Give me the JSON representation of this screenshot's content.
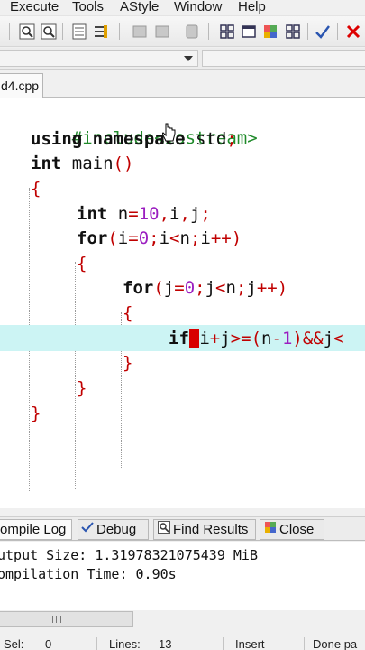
{
  "menu": [
    "Execute",
    "Tools",
    "AStyle",
    "Window",
    "Help"
  ],
  "toolbar": {
    "icons": [
      "find-icon",
      "find-next-icon",
      "goto-icon",
      "bookmark-icon",
      "indent-icon",
      "unindent-icon",
      "toggle-comment-icon",
      "grid-icon",
      "window-icon",
      "layout-icon",
      "tile-icon",
      "check-icon",
      "close-icon"
    ]
  },
  "tab": {
    "filename": "d4.cpp"
  },
  "code": {
    "l1": {
      "pp": "#include<iostream>"
    },
    "l2": {
      "kw": "using namespace",
      "id": "std",
      "sym": ";"
    },
    "l3": {
      "kw": "int",
      "id": "main",
      "sym": "()"
    },
    "l4": {
      "sym": "{"
    },
    "l5": {
      "kw": "int",
      "a": "n",
      "b": "=",
      "n": "10",
      "c": ",",
      "d": "i",
      "e": ",",
      "f": "j",
      "g": ";"
    },
    "l6": {
      "kw": "for",
      "a": "(",
      "b": "i",
      "c": "=",
      "n": "0",
      "d": ";",
      "e": "i",
      "f": "<",
      "g": "n",
      "h": ";",
      "i": "i",
      "j": "++)"
    },
    "l7": {
      "sym": "{"
    },
    "l8": {
      "kw": "for",
      "a": "(",
      "b": "j",
      "c": "=",
      "n": "0",
      "d": ";",
      "e": "j",
      "f": "<",
      "g": "n",
      "h": ";",
      "i": "j",
      "j": "++)"
    },
    "l9": {
      "sym": "{"
    },
    "l10": {
      "kw": "if",
      "a": "i",
      "b": "+",
      "c": "j",
      "d": ">=(",
      "e": "n",
      "f": "-",
      "n": "1",
      "g": ")&&",
      "h": "j",
      "i": "<"
    },
    "l11": {
      "sym": "}"
    },
    "l12": {
      "sym": "}"
    },
    "l13": {
      "sym": "}"
    }
  },
  "bottom_tabs": {
    "compile_log": "ompile Log",
    "debug": "Debug",
    "find_results": "Find Results",
    "close": "Close"
  },
  "output": {
    "line1": "utput Size: 1.31978321075439 MiB",
    "line2": "ompilation Time: 0.90s"
  },
  "status": {
    "sel_label": "Sel:",
    "sel_value": "0",
    "lines_label": "Lines:",
    "lines_value": "13",
    "mode": "Insert",
    "message": "Done pa"
  }
}
